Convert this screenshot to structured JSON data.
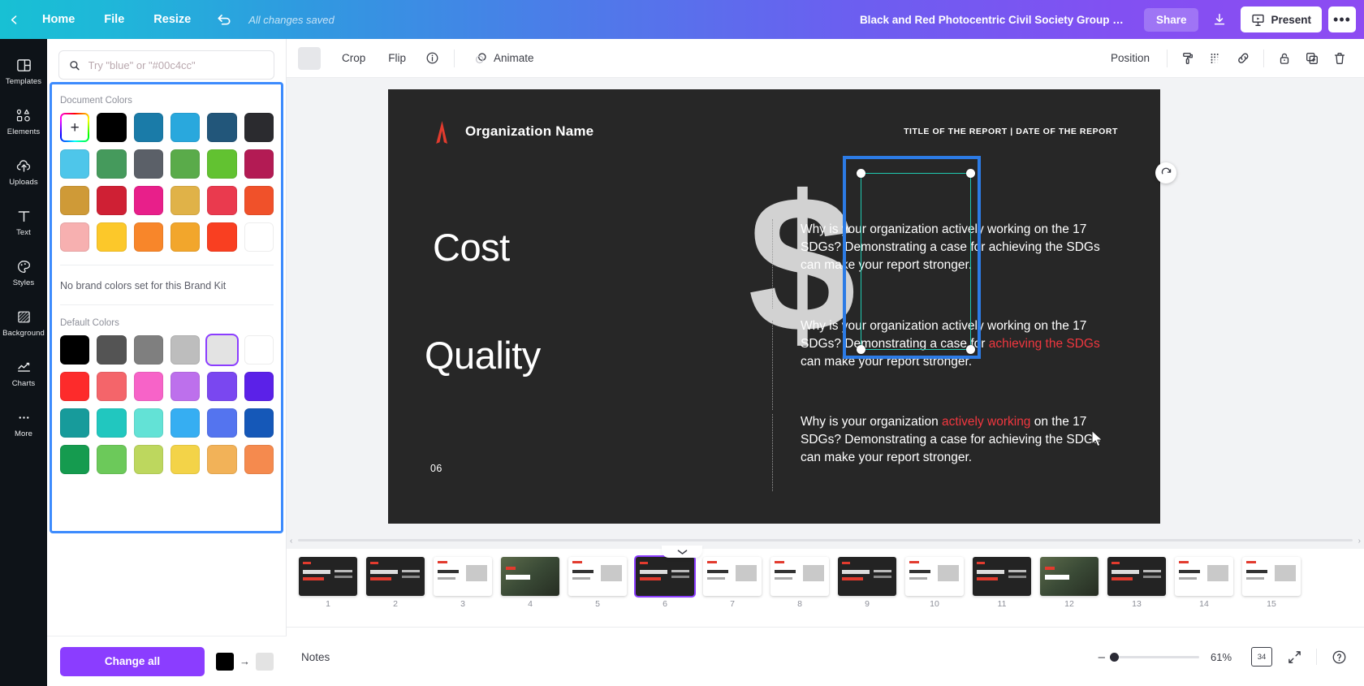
{
  "topbar": {
    "back_icon": "chevron-left-icon",
    "home_label": "Home",
    "file_label": "File",
    "resize_label": "Resize",
    "undo_icon": "undo-icon",
    "saved_status": "All changes saved",
    "doc_title": "Black and Red Photocentric Civil Society Group Progress Re...",
    "share_label": "Share",
    "download_icon": "download-icon",
    "present_label": "Present",
    "present_icon": "present-screen-icon",
    "more_label": "•••"
  },
  "rail": {
    "items": [
      {
        "label": "Templates",
        "icon": "templates-icon"
      },
      {
        "label": "Elements",
        "icon": "elements-icon"
      },
      {
        "label": "Uploads",
        "icon": "uploads-cloud-icon"
      },
      {
        "label": "Text",
        "icon": "text-t-icon"
      },
      {
        "label": "Styles",
        "icon": "styles-palette-icon"
      },
      {
        "label": "Background",
        "icon": "background-hatch-icon"
      },
      {
        "label": "Charts",
        "icon": "charts-line-icon"
      },
      {
        "label": "More",
        "icon": "more-dots-icon"
      }
    ]
  },
  "panel": {
    "search_placeholder": "Try \"blue\" or \"#00c4cc\"",
    "search_value": "",
    "search_icon": "search-icon",
    "document_colors_label": "Document Colors",
    "add_color_label": "+",
    "document_colors": [
      "#000000",
      "#1a7ba8",
      "#29a8dd",
      "#22567a",
      "#2b2b2f",
      "#4ec6ea",
      "#459a5c",
      "#5b6068",
      "#5aab4a",
      "#62c231",
      "#b31b54",
      "#cf9a37",
      "#cf2034",
      "#e81f8a",
      "#e0b248",
      "#ea3a4e",
      "#f0512a",
      "#f7b0b0",
      "#fcc82a",
      "#f8862a",
      "#f2a62c",
      "#f93f21",
      "#ffffff"
    ],
    "brand_note": "No brand colors set for this Brand Kit",
    "default_colors_label": "Default Colors",
    "default_colors": [
      "#000000",
      "#545454",
      "#7f7f7f",
      "#bdbdbd",
      "#e3e3e3",
      "#ffffff",
      "#fd2b2b",
      "#f4656a",
      "#f763c8",
      "#bd70ec",
      "#7a47f0",
      "#5b21e8",
      "#179b9b",
      "#21c7bf",
      "#63e2d6",
      "#36aef2",
      "#5474ef",
      "#1558b8",
      "#159b4f",
      "#6cc95a",
      "#bdd75e",
      "#f3d348",
      "#f2b258",
      "#f58a4e"
    ],
    "selected_default_index": 4,
    "change_all_label": "Change all",
    "swap_from": "#000000",
    "swap_to": "#e3e3e3",
    "swap_arrow": "→"
  },
  "editor_toolbar": {
    "crop_label": "Crop",
    "flip_label": "Flip",
    "info_icon": "info-circle-icon",
    "animate_label": "Animate",
    "animate_icon": "animate-icon",
    "position_label": "Position",
    "transparency_icon": "transparency-icon",
    "color_picker_icon": "paint-roller-icon",
    "link_icon": "link-icon",
    "lock_icon": "lock-icon",
    "duplicate_icon": "duplicate-icon",
    "delete_icon": "trash-icon"
  },
  "slide": {
    "org_name": "Organization Name",
    "report_title": "TITLE OF THE REPORT | DATE OF THE REPORT",
    "heading_1": "Cost",
    "heading_2": "Quality",
    "page_number": "06",
    "dollar_glyph": "$",
    "background_color": "#272727",
    "accent_color": "#f0373f",
    "paragraphs": [
      {
        "pre": "Why is your organization actively working on the 17 SDGs? Demonstrating a case for achieving the SDGs can make your report stronger.",
        "accent": "",
        "post": ""
      },
      {
        "pre": "Why is your organization actively working on the 17 SDGs? Demonstrating a case for ",
        "accent": "achieving the SDGs",
        "post": " can make your report stronger."
      },
      {
        "pre": "Why is your organization ",
        "accent": "actively working",
        "post": " on the 17 SDGs? Demonstrating a case for achieving the SDGs can make your report stronger."
      }
    ]
  },
  "thumbnails": {
    "selected": 6,
    "items": [
      {
        "num": "1",
        "theme": "dark"
      },
      {
        "num": "2",
        "theme": "dark"
      },
      {
        "num": "3",
        "theme": "light"
      },
      {
        "num": "4",
        "theme": "photo"
      },
      {
        "num": "5",
        "theme": "light"
      },
      {
        "num": "6",
        "theme": "dark"
      },
      {
        "num": "7",
        "theme": "light"
      },
      {
        "num": "8",
        "theme": "light"
      },
      {
        "num": "9",
        "theme": "dark"
      },
      {
        "num": "10",
        "theme": "light"
      },
      {
        "num": "11",
        "theme": "dark"
      },
      {
        "num": "12",
        "theme": "photo"
      },
      {
        "num": "13",
        "theme": "dark"
      },
      {
        "num": "14",
        "theme": "light"
      },
      {
        "num": "15",
        "theme": "light"
      }
    ]
  },
  "footer": {
    "notes_label": "Notes",
    "zoom_percent": "61%",
    "zoom_minus": "–",
    "page_count": "34",
    "fullscreen_icon": "expand-icon",
    "help_icon": "help-circle-icon"
  }
}
